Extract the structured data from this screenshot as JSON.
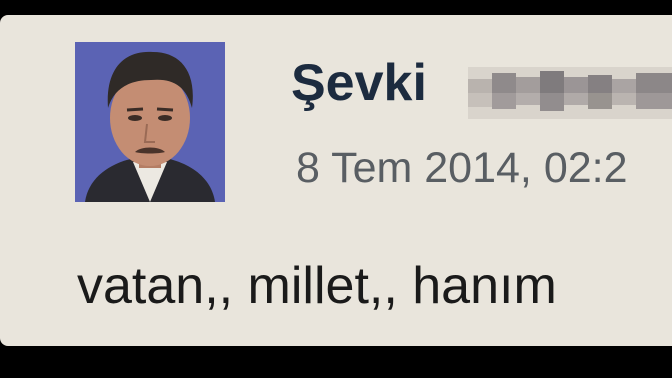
{
  "post": {
    "author_name": "Şevki",
    "timestamp": "8 Tem 2014, 02:2",
    "text": "vatan,, millet,, hanım"
  },
  "icons": {
    "avatar": "profile-photo",
    "surname": "pixelated-redaction"
  },
  "colors": {
    "card_background": "#e9e5dc",
    "name_color": "#1c2b3f",
    "timestamp_color": "#595e63",
    "text_color": "#1a1a1a",
    "frame_color": "#000000"
  }
}
